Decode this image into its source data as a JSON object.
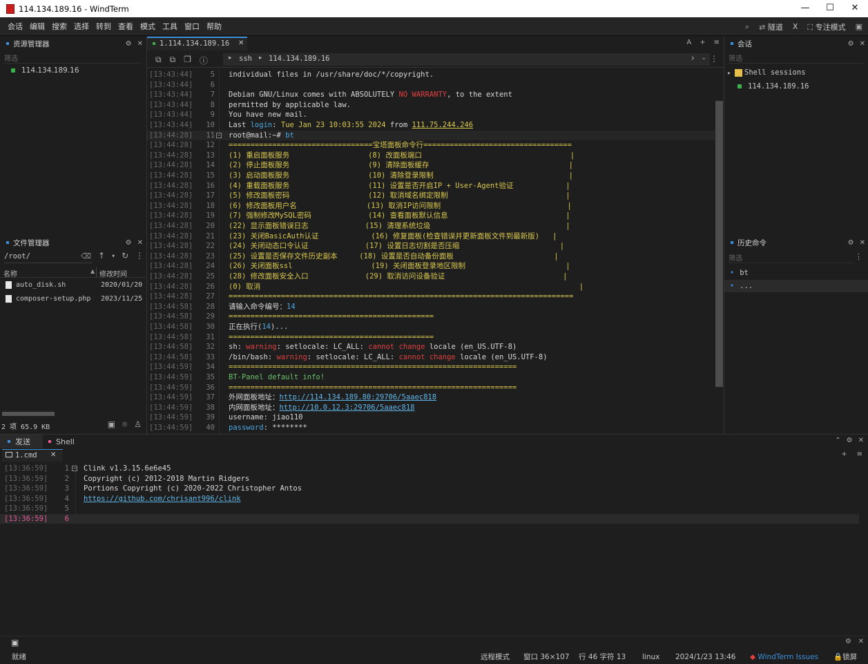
{
  "window": {
    "title": "114.134.189.16 - WindTerm",
    "min": "—",
    "max": "☐",
    "close": "✕"
  },
  "menu": {
    "items": [
      "会话",
      "编辑",
      "搜索",
      "选择",
      "转到",
      "查看",
      "模式",
      "工具",
      "窗口",
      "帮助"
    ],
    "right": {
      "tunnel": "隧道",
      "x": "X",
      "focus": "专注模式"
    }
  },
  "explorer": {
    "title": "资源管理器",
    "filter": "筛选",
    "items": [
      "114.134.189.16"
    ]
  },
  "files": {
    "title": "文件管理器",
    "path": "/root/",
    "col_name": "名称",
    "col_mtime": "修改时间",
    "rows": [
      {
        "name": "auto_disk.sh",
        "mtime": "2020/01/20"
      },
      {
        "name": "composer-setup.php",
        "mtime": "2023/11/25"
      }
    ],
    "footer": "2 项 65.9 KB"
  },
  "tab": {
    "label": "1.114.134.189.16",
    "close": "✕",
    "right_a": "A",
    "right_plus": "+",
    "right_menu": "≡"
  },
  "address": {
    "proto": "ssh",
    "host": "114.134.189.16"
  },
  "terminal": {
    "lines": [
      {
        "ts": "[13:43:44]",
        "n": "5",
        "t": [
          {
            "s": "individual files in /usr/share/doc/*/copyright.",
            "c": ""
          }
        ]
      },
      {
        "ts": "[13:43:44]",
        "n": "6",
        "t": []
      },
      {
        "ts": "[13:43:44]",
        "n": "7",
        "t": [
          {
            "s": "Debian GNU/Linux comes with ABSOLUTELY ",
            "c": ""
          },
          {
            "s": "NO WARRANTY",
            "c": "c-red"
          },
          {
            "s": ", to the extent",
            "c": ""
          }
        ]
      },
      {
        "ts": "[13:43:44]",
        "n": "8",
        "t": [
          {
            "s": "permitted by applicable law.",
            "c": ""
          }
        ]
      },
      {
        "ts": "[13:43:44]",
        "n": "9",
        "t": [
          {
            "s": "You have new mail.",
            "c": ""
          }
        ]
      },
      {
        "ts": "[13:43:44]",
        "n": "10",
        "t": [
          {
            "s": "Last ",
            "c": ""
          },
          {
            "s": "login",
            "c": "c-blue"
          },
          {
            "s": ": ",
            "c": ""
          },
          {
            "s": "Tue Jan 23 10:03:55 2024",
            "c": "c-yellow"
          },
          {
            "s": " from ",
            "c": ""
          },
          {
            "s": "111.75.244.246",
            "c": "c-yellow u"
          }
        ]
      },
      {
        "ts": "[13:44:28]",
        "n": "11",
        "t": [
          {
            "s": "root@mail:~# ",
            "c": ""
          },
          {
            "s": "bt",
            "c": "c-blue"
          }
        ],
        "fold": true
      },
      {
        "ts": "[13:44:28]",
        "n": "12",
        "t": [
          {
            "s": "=================================宝塔面板命令行==================================",
            "c": "c-yellow"
          }
        ]
      },
      {
        "ts": "[13:44:28]",
        "n": "13",
        "t": [
          {
            "s": "(1) 重启面板服务                  (8) 改面板端口                                  |",
            "c": "c-yellow"
          }
        ]
      },
      {
        "ts": "[13:44:28]",
        "n": "14",
        "t": [
          {
            "s": "(2) 停止面板服务                  (9) 清除面板缓存                                |",
            "c": "c-yellow"
          }
        ]
      },
      {
        "ts": "[13:44:28]",
        "n": "15",
        "t": [
          {
            "s": "(3) 启动面板服务                  (10) 清除登录限制                               |",
            "c": "c-yellow"
          }
        ]
      },
      {
        "ts": "[13:44:28]",
        "n": "16",
        "t": [
          {
            "s": "(4) 重载面板服务                  (11) 设置是否开启IP + User-Agent验证            |",
            "c": "c-yellow"
          }
        ]
      },
      {
        "ts": "[13:44:28]",
        "n": "17",
        "t": [
          {
            "s": "(5) 修改面板密码                  (12) 取消域名绑定限制                           |",
            "c": "c-yellow"
          }
        ]
      },
      {
        "ts": "[13:44:28]",
        "n": "18",
        "t": [
          {
            "s": "(6) 修改面板用户名                (13) 取消IP访问限制                             |",
            "c": "c-yellow"
          }
        ]
      },
      {
        "ts": "[13:44:28]",
        "n": "19",
        "t": [
          {
            "s": "(7) 强制修改MySQL密码             (14) 查看面板默认信息                           |",
            "c": "c-yellow"
          }
        ]
      },
      {
        "ts": "[13:44:28]",
        "n": "20",
        "t": [
          {
            "s": "(22) 显示面板错误日志             (15) 清理系统垃圾                               |",
            "c": "c-yellow"
          }
        ]
      },
      {
        "ts": "[13:44:28]",
        "n": "21",
        "t": [
          {
            "s": "(23) 关闭BasicAuth认证            (16) 修复面板(检查错误并更新面板文件到最新版)   |",
            "c": "c-yellow"
          }
        ]
      },
      {
        "ts": "[13:44:28]",
        "n": "22",
        "t": [
          {
            "s": "(24) 关闭动态口令认证             (17) 设置日志切割是否压缩                       |",
            "c": "c-yellow"
          }
        ]
      },
      {
        "ts": "[13:44:28]",
        "n": "23",
        "t": [
          {
            "s": "(25) 设置是否保存文件历史副本     (18) 设置是否自动备份面板                       |",
            "c": "c-yellow"
          }
        ]
      },
      {
        "ts": "[13:44:28]",
        "n": "24",
        "t": [
          {
            "s": "(26) 关闭面板ssl                  (19) 关闭面板登录地区限制                       |",
            "c": "c-yellow"
          }
        ]
      },
      {
        "ts": "[13:44:28]",
        "n": "25",
        "t": [
          {
            "s": "(28) 修改面板安全入口             (29) 取消访问设备验证                           |",
            "c": "c-yellow"
          }
        ]
      },
      {
        "ts": "[13:44:28]",
        "n": "26",
        "t": [
          {
            "s": "(0) 取消                                                                         |",
            "c": "c-yellow"
          }
        ]
      },
      {
        "ts": "[13:44:28]",
        "n": "27",
        "t": [
          {
            "s": "===============================================================================",
            "c": "c-yellow"
          }
        ]
      },
      {
        "ts": "[13:44:58]",
        "n": "28",
        "t": [
          {
            "s": "请输入命令编号：",
            "c": ""
          },
          {
            "s": "14",
            "c": "c-blue"
          }
        ]
      },
      {
        "ts": "[13:44:58]",
        "n": "29",
        "t": [
          {
            "s": "===============================================",
            "c": "c-yellow"
          }
        ]
      },
      {
        "ts": "[13:44:58]",
        "n": "30",
        "t": [
          {
            "s": "正在执行(",
            "c": ""
          },
          {
            "s": "14",
            "c": "c-blue"
          },
          {
            "s": ")...",
            "c": ""
          }
        ]
      },
      {
        "ts": "[13:44:58]",
        "n": "31",
        "t": [
          {
            "s": "===============================================",
            "c": "c-yellow"
          }
        ]
      },
      {
        "ts": "[13:44:58]",
        "n": "32",
        "t": [
          {
            "s": "sh: ",
            "c": ""
          },
          {
            "s": "warning",
            "c": "c-red"
          },
          {
            "s": ": setlocale: LC_ALL: ",
            "c": ""
          },
          {
            "s": "cannot change",
            "c": "c-red"
          },
          {
            "s": " locale (en_US.UTF-8)",
            "c": ""
          }
        ]
      },
      {
        "ts": "[13:44:58]",
        "n": "33",
        "t": [
          {
            "s": "/bin/bash: ",
            "c": ""
          },
          {
            "s": "warning",
            "c": "c-red"
          },
          {
            "s": ": setlocale: LC_ALL: ",
            "c": ""
          },
          {
            "s": "cannot change",
            "c": "c-red"
          },
          {
            "s": " locale (en_US.UTF-8)",
            "c": ""
          }
        ]
      },
      {
        "ts": "[13:44:59]",
        "n": "34",
        "t": [
          {
            "s": "==================================================================",
            "c": "c-yellow"
          }
        ]
      },
      {
        "ts": "[13:44:59]",
        "n": "35",
        "t": [
          {
            "s": "BT-Panel default info!",
            "c": "c-green"
          }
        ]
      },
      {
        "ts": "[13:44:59]",
        "n": "36",
        "t": [
          {
            "s": "==================================================================",
            "c": "c-yellow"
          }
        ]
      },
      {
        "ts": "[13:44:59]",
        "n": "37",
        "t": [
          {
            "s": "外网面板地址：",
            "c": ""
          },
          {
            "s": "http://114.134.189.80:29706/5aaec818",
            "c": "c-link"
          }
        ]
      },
      {
        "ts": "[13:44:59]",
        "n": "38",
        "t": [
          {
            "s": "内网面板地址：",
            "c": ""
          },
          {
            "s": "http://10.0.12.3:29706/5aaec818",
            "c": "c-link"
          }
        ]
      },
      {
        "ts": "[13:44:59]",
        "n": "39",
        "t": [
          {
            "s": "username: jiao110",
            "c": ""
          }
        ]
      },
      {
        "ts": "[13:44:59]",
        "n": "40",
        "t": [
          {
            "s": "password",
            "c": "c-blue"
          },
          {
            "s": ": ********",
            "c": ""
          }
        ]
      }
    ]
  },
  "sessions": {
    "title": "会话",
    "filter": "筛选",
    "folder": "Shell sessions",
    "item": "114.134.189.16"
  },
  "history": {
    "title": "历史命令",
    "filter": "筛选",
    "items": [
      "bt",
      "..."
    ]
  },
  "bottom": {
    "tab_send": "发送",
    "tab_shell": "Shell",
    "subtab": "1.cmd",
    "subtab_close": "✕",
    "lines": [
      {
        "ts": "[13:36:59]",
        "n": "1",
        "t": "Clink v1.3.15.6e6e45",
        "link": false
      },
      {
        "ts": "[13:36:59]",
        "n": "2",
        "t": "Copyright (c) 2012-2018 Martin Ridgers",
        "link": false
      },
      {
        "ts": "[13:36:59]",
        "n": "3",
        "t": "Portions Copyright (c) 2020-2022 Christopher Antos",
        "link": false
      },
      {
        "ts": "[13:36:59]",
        "n": "4",
        "t": "https://github.com/chrisant996/clink",
        "link": true
      },
      {
        "ts": "[13:36:59]",
        "n": "5",
        "t": "",
        "link": false
      },
      {
        "ts": "[13:36:59]",
        "n": "6",
        "t": "",
        "link": false,
        "active": true
      }
    ]
  },
  "status": {
    "ready": "就绪",
    "mode": "远程模式",
    "window": "窗口 36×107",
    "pos": "行 46 字符 13",
    "os": "linux",
    "datetime": "2024/1/23 13:46",
    "issues": "WindTerm Issues",
    "lock": "锁屏"
  }
}
